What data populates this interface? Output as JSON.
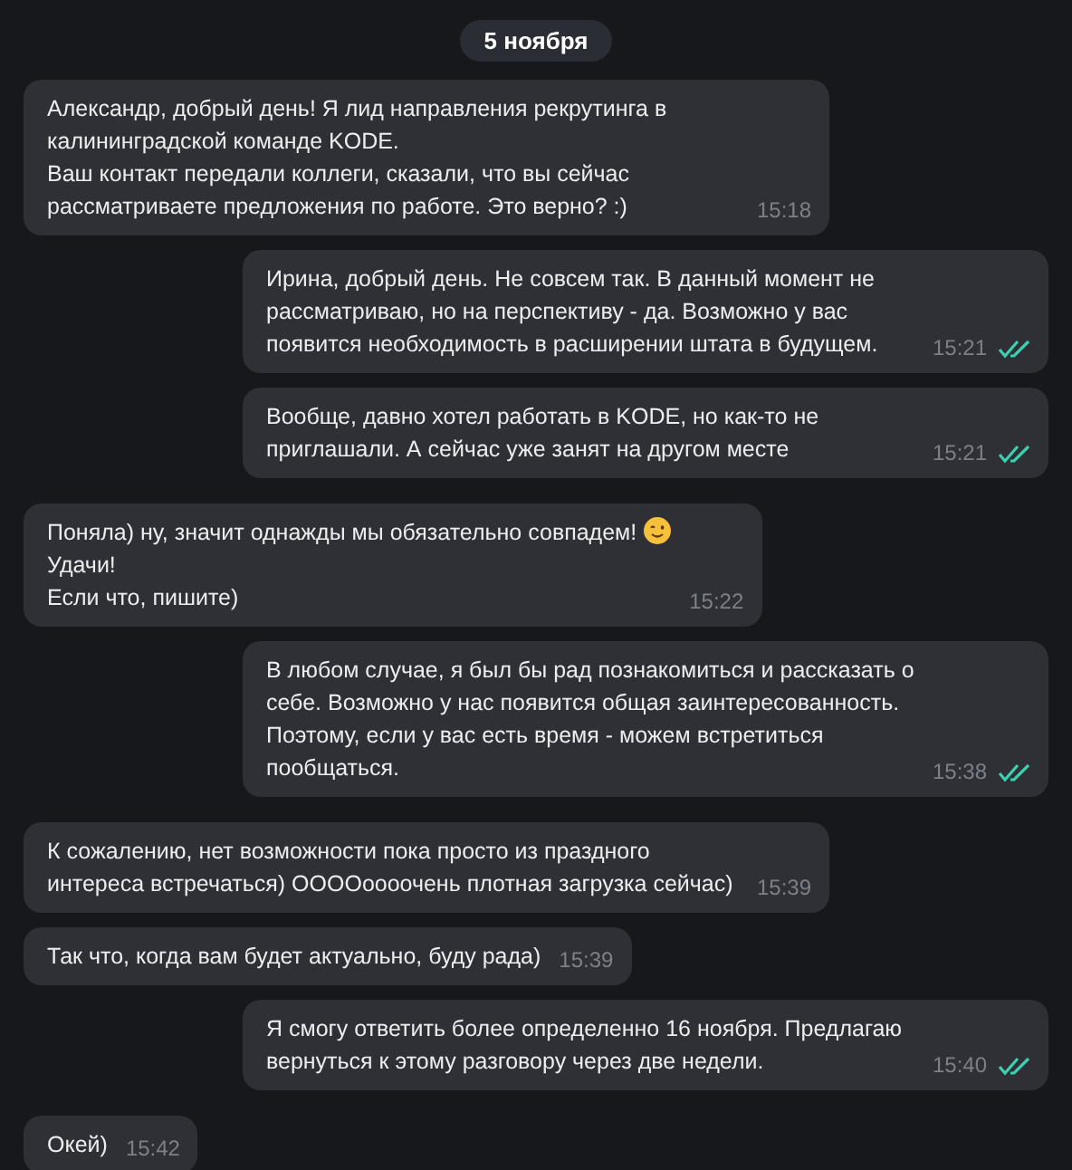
{
  "date_label": "5 ноября",
  "messages": [
    {
      "kind": "incoming",
      "text": "Александр, добрый день! Я лид направления рекрутинга в калининградской команде KODE.\nВаш контакт передали коллеги, сказали, что вы сейчас рассматриваете предложения по работе. Это верно? :)",
      "time": "15:18"
    },
    {
      "kind": "outgoing",
      "text": "Ирина, добрый день. Не совсем так. В данный момент не рассматриваю, но на перспективу - да. Возможно у вас появится необходимость в расширении штата в будущем.",
      "time": "15:21",
      "read": true
    },
    {
      "kind": "outgoing",
      "text": "Вообще, давно хотел работать в KODE, но как-то не приглашали. А сейчас уже занят на другом месте",
      "time": "15:21",
      "read": true
    },
    {
      "kind": "incoming",
      "text": "Поняла) ну, значит однажды мы обязательно совпадем!",
      "wink_emoji": true,
      "text_after": "Удачи!\nЕсли что, пишите)",
      "time": "15:22"
    },
    {
      "kind": "outgoing",
      "text": "В любом случае, я был бы рад познакомиться и рассказать о себе. Возможно у нас появится общая заинтересованность. Поэтому, если у вас есть время - можем встретиться пообщаться.",
      "time": "15:38",
      "read": true
    },
    {
      "kind": "incoming",
      "text": "К сожалению, нет возможности пока просто из праздного интереса встречаться) ООООоооочень плотная загрузка сейчас)",
      "time": "15:39"
    },
    {
      "kind": "incoming",
      "text": "Так что, когда вам будет актуально, буду рада)",
      "time": "15:39"
    },
    {
      "kind": "outgoing",
      "text": "Я смогу ответить более определенно 16 ноября. Предлагаю вернуться к этому разговору через две недели.",
      "time": "15:40",
      "read": true
    },
    {
      "kind": "incoming",
      "text": "Окей)",
      "time": "15:42"
    }
  ]
}
